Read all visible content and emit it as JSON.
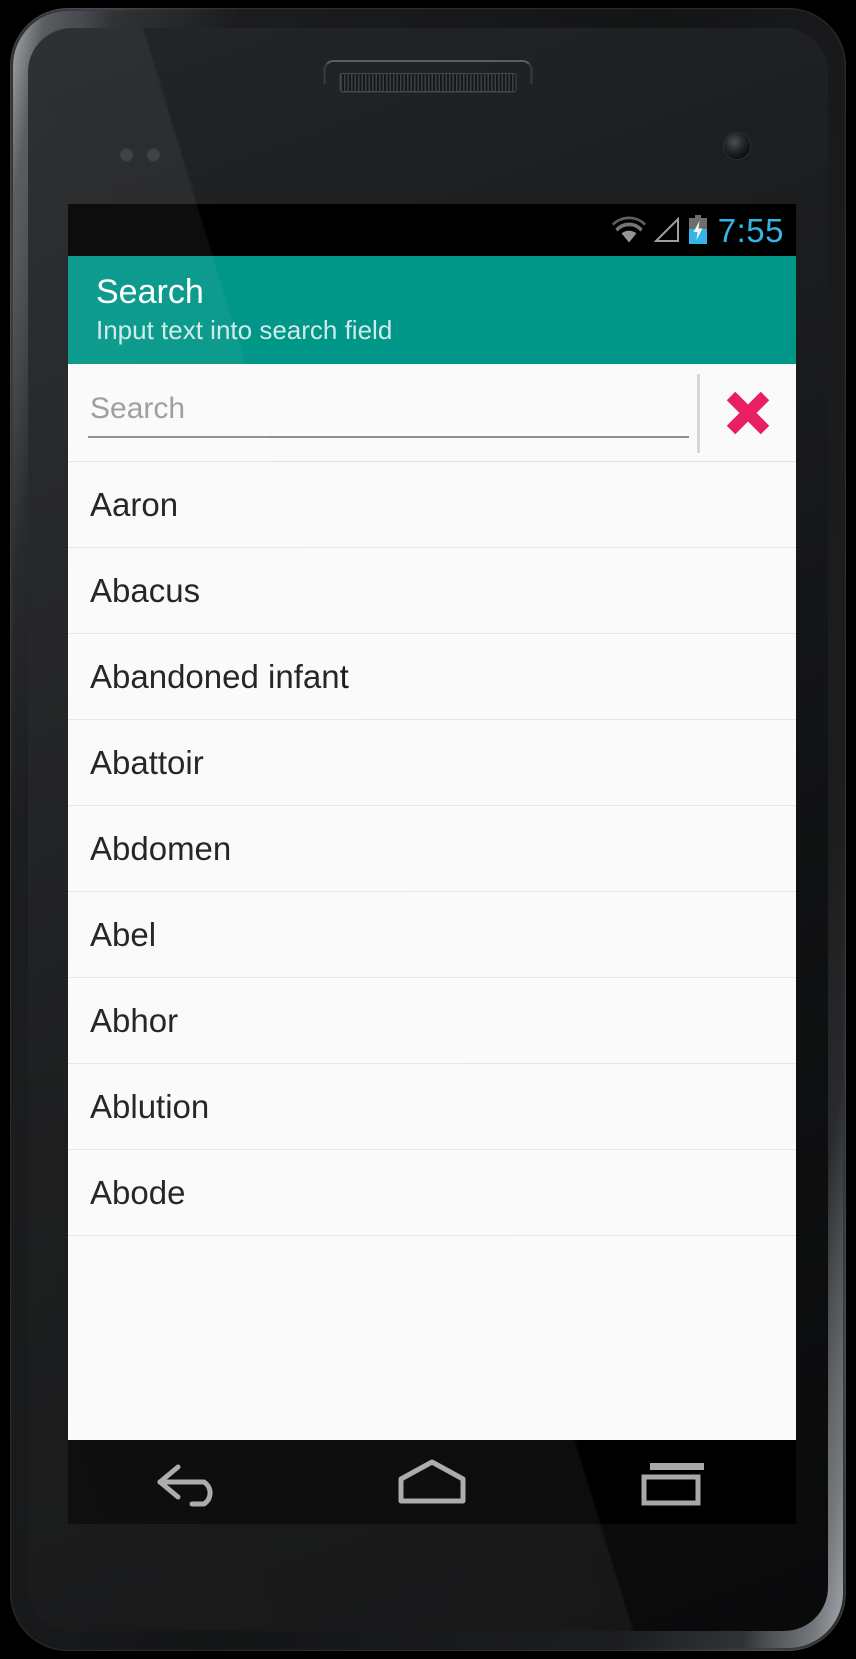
{
  "device": {
    "type": "android-phone-mockup",
    "earpiece": "earpiece-speaker",
    "front_camera": "front-camera"
  },
  "status_bar": {
    "time": "7:55",
    "time_color": "#33b5e5",
    "background": "#000000",
    "icons": [
      {
        "name": "wifi-icon",
        "label": "WiFi signal"
      },
      {
        "name": "cellular-signal-icon",
        "label": "No cellular signal"
      },
      {
        "name": "battery-charging-icon",
        "label": "Battery charging"
      }
    ]
  },
  "action_bar": {
    "title": "Search",
    "subtitle": "Input text into search field",
    "background": "#009688",
    "title_color": "#ffffff",
    "subtitle_color": "#cfeae7"
  },
  "search": {
    "placeholder": "Search",
    "value": "",
    "clear_icon": "close-x-icon",
    "clear_icon_color": "#e91e63"
  },
  "list": {
    "items": [
      {
        "label": "Aaron"
      },
      {
        "label": "Abacus"
      },
      {
        "label": "Abandoned infant"
      },
      {
        "label": "Abattoir"
      },
      {
        "label": "Abdomen"
      },
      {
        "label": "Abel"
      },
      {
        "label": "Abhor"
      },
      {
        "label": "Ablution"
      },
      {
        "label": "Abode"
      }
    ]
  },
  "nav_bar": {
    "background": "#000000",
    "buttons": [
      {
        "name": "back-button",
        "icon": "back-arrow-icon"
      },
      {
        "name": "home-button",
        "icon": "home-icon"
      },
      {
        "name": "recents-button",
        "icon": "recents-icon"
      }
    ]
  }
}
